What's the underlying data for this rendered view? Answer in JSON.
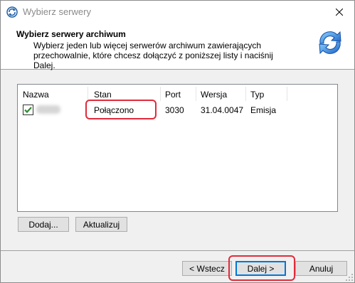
{
  "window": {
    "title": "Wybierz serwery"
  },
  "header": {
    "title": "Wybierz serwery archiwum",
    "description": "Wybierz jeden lub więcej serwerów archiwum zawierających przechowalnie, które chcesz dołączyć z poniższej listy i naciśnij Dalej.",
    "icon": "refresh-arrows-icon"
  },
  "list": {
    "columns": [
      "Nazwa",
      "Stan",
      "Port",
      "Wersja",
      "Typ"
    ],
    "rows": [
      {
        "checked": true,
        "name_redacted": true,
        "status": "Połączono",
        "port": "3030",
        "version": "31.04.0047",
        "type": "Emisja"
      }
    ]
  },
  "buttons": {
    "add": "Dodaj...",
    "refresh": "Aktualizuj",
    "back": "< Wstecz",
    "next": "Dalej >",
    "cancel": "Anuluj"
  },
  "colors": {
    "highlight": "#e02b3b",
    "check": "#2a8c2a",
    "default_button_border": "#0078d7"
  }
}
